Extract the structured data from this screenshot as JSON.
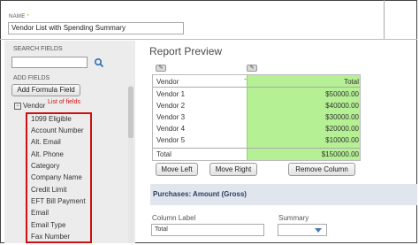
{
  "form": {
    "name_label": "NAME",
    "required_mark": "*",
    "name_value": "Vendor List with Spending Summary"
  },
  "sidebar": {
    "search_label": "SEARCH FIELDS",
    "search_icon": "search-icon",
    "add_fields_label": "ADD FIELDS",
    "add_formula_label": "Add Formula Field",
    "group_label": "Vendor",
    "annotation": "List of fields",
    "fields": [
      "1099 Eligible",
      "Account Number",
      "Alt. Email",
      "Alt. Phone",
      "Category",
      "Company Name",
      "Credit Limit",
      "EFT Bill Payment",
      "Email",
      "Email Type",
      "Fax Number"
    ]
  },
  "preview": {
    "title": "Report Preview",
    "col_vendor": "Vendor",
    "col_total": "Total",
    "rows": [
      {
        "vendor": "Vendor 1",
        "total": "$50000.00"
      },
      {
        "vendor": "Vendor 2",
        "total": "$40000.00"
      },
      {
        "vendor": "Vendor 3",
        "total": "$30000.00"
      },
      {
        "vendor": "Vendor 4",
        "total": "$20000.00"
      },
      {
        "vendor": "Vendor 5",
        "total": "$10000.00"
      }
    ],
    "total_label": "Total",
    "total_value": "$150000.00",
    "highlight_color": "#b5f095"
  },
  "buttons": {
    "move_left": "Move Left",
    "move_right": "Move Right",
    "remove_column": "Remove Column"
  },
  "properties": {
    "title": "Purchases: Amount (Gross)",
    "column_label_label": "Column Label",
    "column_label_value": "Total",
    "summary_label": "Summary",
    "summary_value": ""
  }
}
